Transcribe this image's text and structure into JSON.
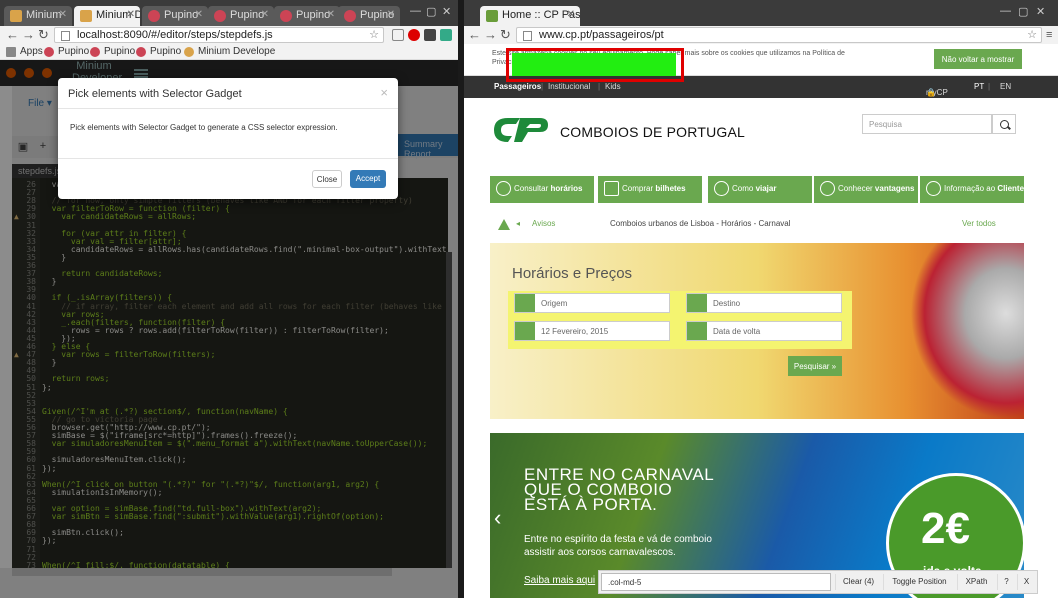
{
  "left_browser": {
    "tabs": [
      {
        "label": "Minium",
        "active": false
      },
      {
        "label": "Minium Deve",
        "active": true
      },
      {
        "label": "Pupino",
        "active": false
      },
      {
        "label": "Pupino",
        "active": false
      },
      {
        "label": "Pupino",
        "active": false
      },
      {
        "label": "Pupino",
        "active": false
      }
    ],
    "url": "localhost:8090/#/editor/steps/stepdefs.js",
    "bookmarks": [
      "Apps",
      "Pupino",
      "Pupino",
      "Pupino",
      "Minium Develope"
    ]
  },
  "minium_app": {
    "brand": "Minium Developer",
    "file_menu": "File",
    "report_button": "Summary Report",
    "file_tab": "stepdefs.js*",
    "code_lines": [
      {
        "n": "26",
        "text": "  var"
      },
      {
        "n": "27",
        "text": ""
      },
      {
        "n": "28",
        "text": "  // for now, only simple filters (behaves like AND for each filter property)"
      },
      {
        "n": "29",
        "text": "  var filterToRow = function (filter) {"
      },
      {
        "n": "30",
        "text": "    var candidateRows = allRows;"
      },
      {
        "n": "31",
        "text": ""
      },
      {
        "n": "32",
        "text": "    for (var attr in filter) {"
      },
      {
        "n": "33",
        "text": "      var val = filter[attr];"
      },
      {
        "n": "34",
        "text": "      candidateRows = allRows.has(candidateRows.find(\".minimal-box-output\").withText(val).below(header"
      },
      {
        "n": "35",
        "text": "    }"
      },
      {
        "n": "36",
        "text": ""
      },
      {
        "n": "37",
        "text": "    return candidateRows;"
      },
      {
        "n": "38",
        "text": "  }"
      },
      {
        "n": "39",
        "text": ""
      },
      {
        "n": "40",
        "text": "  if (_.isArray(filters)) {"
      },
      {
        "n": "41",
        "text": "    // if array, filter each element and add all rows for each filter (behaves like a OR)"
      },
      {
        "n": "42",
        "text": "    var rows;"
      },
      {
        "n": "43",
        "text": "    _.each(filters, function(filter) {"
      },
      {
        "n": "44",
        "text": "      rows = rows ? rows.add(filterToRow(filter)) : filterToRow(filter);"
      },
      {
        "n": "45",
        "text": "    });"
      },
      {
        "n": "46",
        "text": "  } else {"
      },
      {
        "n": "47",
        "text": "    var rows = filterToRow(filters);"
      },
      {
        "n": "48",
        "text": "  }"
      },
      {
        "n": "49",
        "text": ""
      },
      {
        "n": "50",
        "text": "  return rows;"
      },
      {
        "n": "51",
        "text": "};"
      },
      {
        "n": "52",
        "text": ""
      },
      {
        "n": "53",
        "text": ""
      },
      {
        "n": "54",
        "text": "Given(/^I'm at (.*?) section$/, function(navName) {"
      },
      {
        "n": "55",
        "text": "  // go to victoria page"
      },
      {
        "n": "56",
        "text": "  browser.get(\"http://www.cp.pt/\");"
      },
      {
        "n": "57",
        "text": "  simBase = $(\"iframe[src*=http]\").frames().freeze();"
      },
      {
        "n": "58",
        "text": "  var simuladoresMenuItem = $(\".menu_format a\").withText(navName.toUpperCase());"
      },
      {
        "n": "59",
        "text": ""
      },
      {
        "n": "60",
        "text": "  simuladoresMenuItem.click();"
      },
      {
        "n": "61",
        "text": "});"
      },
      {
        "n": "62",
        "text": ""
      },
      {
        "n": "63",
        "text": "When(/^I click on button \"(.*?)\" for \"(.*?)\"$/, function(arg1, arg2) {"
      },
      {
        "n": "64",
        "text": "  simulationIsInMemory();"
      },
      {
        "n": "65",
        "text": ""
      },
      {
        "n": "66",
        "text": "  var option = simBase.find(\"td.full-box\").withText(arg2);"
      },
      {
        "n": "67",
        "text": "  var simBtn = simBase.find(\":submit\").withValue(arg1).rightOf(option);"
      },
      {
        "n": "68",
        "text": ""
      },
      {
        "n": "69",
        "text": "  simBtn.click();"
      },
      {
        "n": "70",
        "text": "});"
      },
      {
        "n": "71",
        "text": ""
      },
      {
        "n": "72",
        "text": ""
      },
      {
        "n": "73",
        "text": "When(/^I fill:$/, function(datatable) {"
      }
    ],
    "warning_lines": [
      4,
      21
    ]
  },
  "modal": {
    "title": "Pick elements with Selector Gadget",
    "close_glyph": "×",
    "body": "Pick elements with Selector Gadget to generate a CSS selector expression.",
    "close_label": "Close",
    "accept_label": "Accept"
  },
  "right_browser": {
    "tab": "Home :: CP Passagei",
    "url": "www.cp.pt/passageiros/pt"
  },
  "cp_site": {
    "cookie_text": "Este site armazena cookies no seu equipamento. Pode saber mais sobre os cookies que utilizamos na Política de Privacidade.",
    "cookie_button": "Não voltar a mostrar",
    "nav": [
      "Passageiros",
      "Institucional",
      "Kids"
    ],
    "mycp": "myCP",
    "lang_pt": "PT",
    "lang_en": "EN",
    "logo_text": "COMBOIOS DE PORTUGAL",
    "search_placeholder": "Pesquisa",
    "menu": [
      {
        "pre": "Consultar ",
        "bold": "horários"
      },
      {
        "pre": "Comprar ",
        "bold": "bilhetes"
      },
      {
        "pre": "Como ",
        "bold": "viajar"
      },
      {
        "pre": "Conhecer ",
        "bold": "vantagens"
      },
      {
        "pre": "Informação ao ",
        "bold": "Cliente"
      }
    ],
    "alert_label": "Avisos",
    "alert_text": "Comboios urbanos de Lisboa - Horários - Carnaval",
    "alert_link": "Ver todos",
    "hero_title": "Horários e Preços",
    "origin_placeholder": "Origem",
    "destination_placeholder": "Destino",
    "date_value": "12 Fevereiro, 2015",
    "return_placeholder": "Data de volta",
    "search_button": "Pesquisar »",
    "carnaval_title_1": "ENTRE NO CARNAVAL",
    "carnaval_title_2": "QUE O COMBOIO",
    "carnaval_title_3": "ESTÁ À PORTA.",
    "carnaval_sub": "Entre no espírito da festa e vá de comboio assistir aos corsos carnavalescos.",
    "carnaval_link": "Saiba mais aqui",
    "badge_price": "2€",
    "badge_sub": "ida e volta"
  },
  "selector_gadget": {
    "value": ".col-md-5",
    "clear": "Clear (4)",
    "toggle": "Toggle Position",
    "xpath": "XPath",
    "help": "?",
    "close": "X"
  }
}
